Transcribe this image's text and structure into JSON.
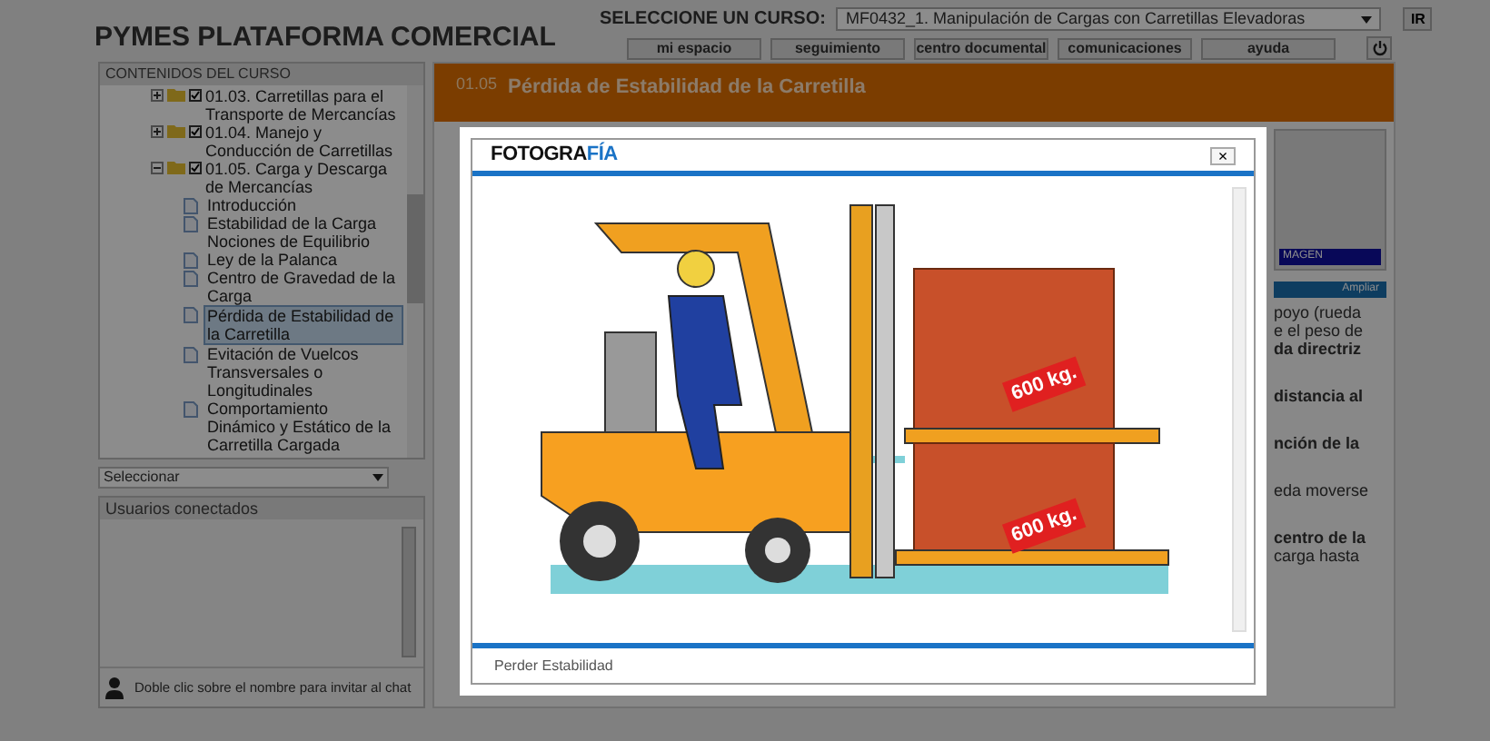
{
  "header": {
    "title": "PYMES PLATAFORMA COMERCIAL",
    "course_label": "SELECCIONE UN CURSO:",
    "course_value": "MF0432_1. Manipulación de Cargas con Carretillas Elevadoras",
    "go_button": "IR",
    "nav_buttons": [
      "mi espacio",
      "seguimiento",
      "centro documental",
      "comunicaciones",
      "ayuda"
    ]
  },
  "course_contents": {
    "title": "CONTENIDOS DEL CURSO",
    "tree": [
      {
        "label": "01.03. Carretillas para el Transporte de Mercancías",
        "expanded": false,
        "checked": true
      },
      {
        "label": "01.04. Manejo y Conducción de Carretillas",
        "expanded": false,
        "checked": true
      },
      {
        "label": "01.05. Carga y Descarga de Mercancías",
        "expanded": true,
        "checked": true,
        "children": [
          {
            "label": "Introducción",
            "selected": false
          },
          {
            "label": "Estabilidad de la Carga Nociones de Equilibrio",
            "selected": false
          },
          {
            "label": "Ley de la Palanca",
            "selected": false
          },
          {
            "label": "Centro de Gravedad de la Carga",
            "selected": false
          },
          {
            "label": "Pérdida de Estabilidad de la Carretilla",
            "selected": true
          },
          {
            "label": "Evitación de Vuelcos Transversales o Longitudinales",
            "selected": false
          },
          {
            "label": "Comportamiento Dinámico y Estático de la Carretilla Cargada",
            "selected": false
          }
        ]
      }
    ],
    "select_value": "Seleccionar"
  },
  "users_panel": {
    "title": "Usuarios conectados",
    "hint": "Doble clic sobre el nombre para invitar al chat"
  },
  "lesson": {
    "number": "01.05",
    "title": "Pérdida de Estabilidad de la Carretilla",
    "image_caption": "MAGEN",
    "zoom_link": "Ampliar",
    "text_fragments": [
      {
        "text": "poyo (rueda",
        "bold": false
      },
      {
        "text": "e el peso de",
        "bold": false
      },
      {
        "text": "da directriz",
        "bold": true
      },
      {
        "text": "distancia al",
        "bold": true
      },
      {
        "text": "nción de la",
        "bold": true
      },
      {
        "text": "eda moverse",
        "bold": false
      },
      {
        "text": "centro de la",
        "bold": true
      },
      {
        "text": "carga hasta",
        "bold": false
      }
    ]
  },
  "modal": {
    "title_prefix": "FOTOGRA",
    "title_suffix": "FÍA",
    "close": "×",
    "illustration_labels": [
      "600 kg.",
      "600 kg."
    ],
    "caption": "Perder Estabilidad"
  }
}
